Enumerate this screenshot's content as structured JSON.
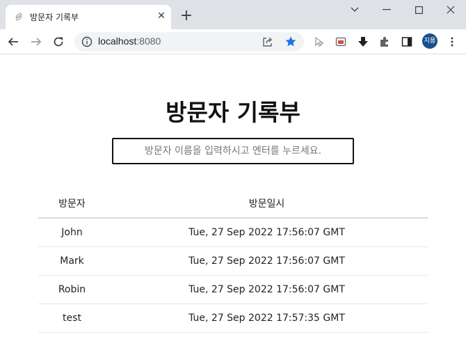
{
  "browser": {
    "tab_title": "방문자 기록부",
    "url_host": "localhost",
    "url_port": ":8080",
    "profile_initials": "지용",
    "profile_color": "#1a4f8b",
    "star_color": "#1a73e8"
  },
  "page": {
    "title": "방문자 기록부",
    "input_placeholder": "방문자 이름을 입력하시고 엔터를 누르세요."
  },
  "table": {
    "headers": [
      "방문자",
      "방문일시"
    ],
    "rows": [
      [
        "John",
        "Tue, 27 Sep 2022 17:56:07 GMT"
      ],
      [
        "Mark",
        "Tue, 27 Sep 2022 17:56:07 GMT"
      ],
      [
        "Robin",
        "Tue, 27 Sep 2022 17:56:07 GMT"
      ],
      [
        "test",
        "Tue, 27 Sep 2022 17:57:35 GMT"
      ]
    ]
  }
}
